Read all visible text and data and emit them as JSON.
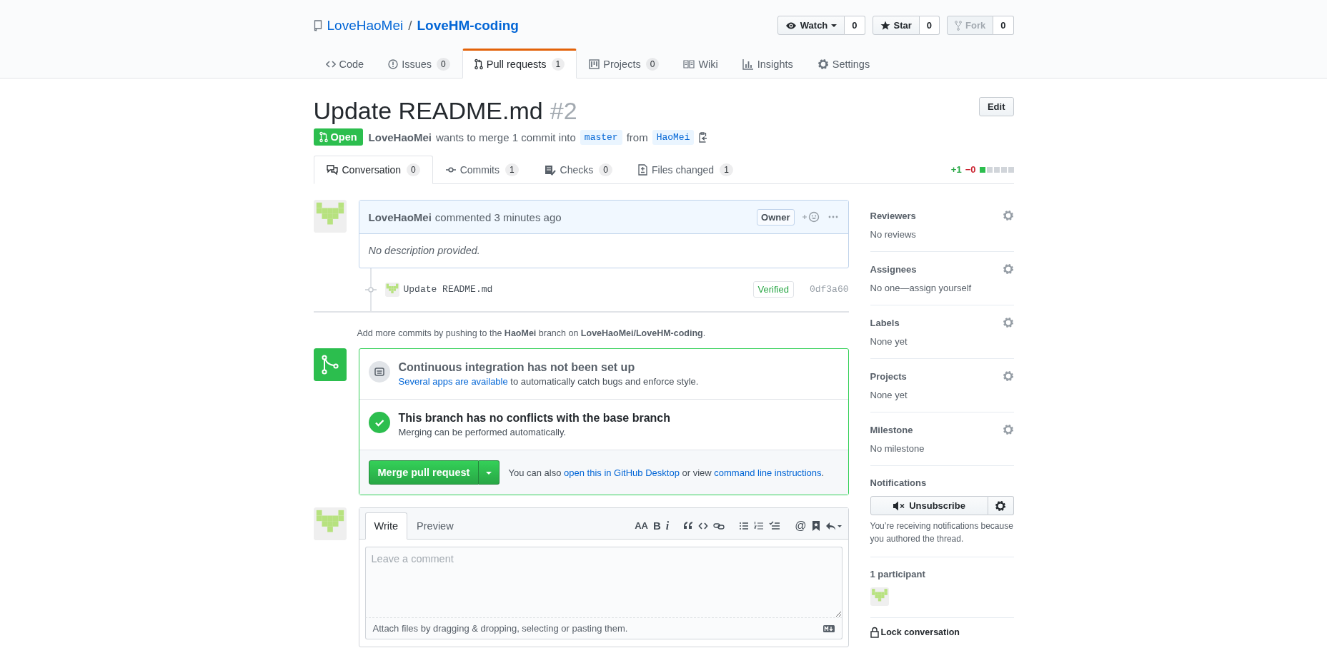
{
  "repo": {
    "owner": "LoveHaoMei",
    "separator": "/",
    "name": "LoveHM-coding"
  },
  "repo_actions": [
    {
      "kind": "watch",
      "label": "Watch",
      "count": "0",
      "disabled": false
    },
    {
      "kind": "star",
      "label": "Star",
      "count": "0",
      "disabled": false
    },
    {
      "kind": "fork",
      "label": "Fork",
      "count": "0",
      "disabled": true
    }
  ],
  "repo_tabs": [
    {
      "kind": "code",
      "label": "Code",
      "selected": false
    },
    {
      "kind": "issues",
      "label": "Issues",
      "count": "0",
      "selected": false
    },
    {
      "kind": "pulls",
      "label": "Pull requests",
      "count": "1",
      "selected": true
    },
    {
      "kind": "projects",
      "label": "Projects",
      "count": "0",
      "selected": false
    },
    {
      "kind": "wiki",
      "label": "Wiki",
      "selected": false
    },
    {
      "kind": "insights",
      "label": "Insights",
      "selected": false
    },
    {
      "kind": "settings",
      "label": "Settings",
      "selected": false
    }
  ],
  "pull_request": {
    "title": "Update README.md",
    "number": "#2",
    "edit_button": "Edit",
    "state": "Open",
    "author": "LoveHaoMei",
    "merge_text": "wants to merge 1 commit into",
    "base_branch": "master",
    "from_text": "from",
    "head_branch": "HaoMei"
  },
  "pr_tabs": [
    {
      "kind": "conversation",
      "label": "Conversation",
      "count": "0",
      "selected": true
    },
    {
      "kind": "commits",
      "label": "Commits",
      "count": "1",
      "selected": false
    },
    {
      "kind": "checks",
      "label": "Checks",
      "count": "0",
      "selected": false
    },
    {
      "kind": "files",
      "label": "Files changed",
      "count": "1",
      "selected": false
    }
  ],
  "diffstat": {
    "additions": "+1",
    "deletions": "−0",
    "blocks": [
      {
        "color": "#2cbe4e"
      },
      {
        "color": "#d1d5da"
      },
      {
        "color": "#d1d5da"
      },
      {
        "color": "#d1d5da"
      },
      {
        "color": "#d1d5da"
      }
    ]
  },
  "comment": {
    "author": "LoveHaoMei",
    "action": "commented 3 minutes ago",
    "role": "Owner",
    "body": "No description provided."
  },
  "commit": {
    "message": "Update README.md",
    "verified": "Verified",
    "sha": "0df3a60"
  },
  "push_hint": "Add more commits by pushing to the **HaoMei** branch on **LoveHaoMei/LoveHM-coding**.",
  "merge_sections": [
    {
      "kind": "ci",
      "title": "Continuous integration has not been set up",
      "link": "Several apps are available",
      "text": " to automatically catch bugs and enforce style."
    },
    {
      "kind": "clean",
      "title": "This branch has no conflicts with the base branch",
      "text": "Merging can be performed automatically."
    }
  ],
  "merge": {
    "button": "Merge pull request",
    "note": [
      {
        "text": "You can also "
      },
      {
        "link": "open this in GitHub Desktop"
      },
      {
        "text": " or view "
      },
      {
        "link": "command line instructions"
      },
      {
        "text": "."
      }
    ]
  },
  "comment_form": {
    "tabs": [
      {
        "label": "Write",
        "selected": true
      },
      {
        "label": "Preview",
        "selected": false
      }
    ],
    "toolbar": [
      {
        "kind": "heading",
        "glyph": "AA"
      },
      {
        "kind": "bold",
        "glyph": "B"
      },
      {
        "kind": "italic",
        "glyph": "i"
      },
      {
        "kind": "quote"
      },
      {
        "kind": "code"
      },
      {
        "kind": "link"
      },
      {
        "kind": "ul"
      },
      {
        "kind": "ol"
      },
      {
        "kind": "tasks"
      },
      {
        "kind": "mention",
        "glyph": "@"
      },
      {
        "kind": "reference"
      },
      {
        "kind": "reply"
      }
    ],
    "placeholder": "Leave a comment",
    "attach_hint": "Attach files by dragging & dropping, selecting or pasting them."
  },
  "sidebar": {
    "sections": [
      {
        "heading": "Reviewers",
        "value": "No reviews"
      },
      {
        "heading": "Assignees",
        "value": "No one—assign yourself"
      },
      {
        "heading": "Labels",
        "value": "None yet"
      },
      {
        "heading": "Projects",
        "value": "None yet"
      },
      {
        "heading": "Milestone",
        "value": "No milestone"
      }
    ],
    "notifications": {
      "heading": "Notifications",
      "button": "Unsubscribe",
      "note": "You’re receiving notifications because you authored the thread."
    },
    "participants": {
      "heading": "1 participant"
    },
    "lock": "Lock conversation"
  }
}
